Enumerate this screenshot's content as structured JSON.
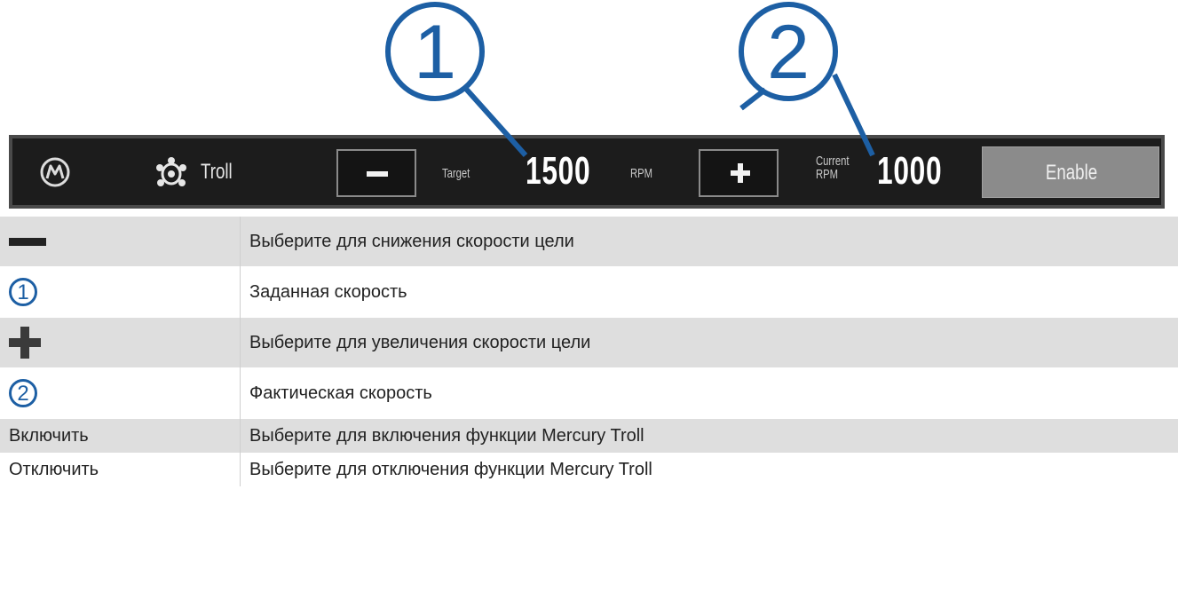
{
  "callouts": [
    "1",
    "2"
  ],
  "toolbar": {
    "mode_label": "Troll",
    "target_label": "Target",
    "target_value": "1500",
    "rpm_label": "RPM",
    "current_label_line1": "Current",
    "current_label_line2": "RPM",
    "current_value": "1000",
    "enable_label": "Enable"
  },
  "legend": {
    "rows": [
      {
        "icon": "minus-icon",
        "description": "Выберите для снижения скорости цели"
      },
      {
        "icon": "callout-1-icon",
        "label": "1",
        "description": "Заданная скорость"
      },
      {
        "icon": "plus-icon",
        "description": "Выберите для увеличения скорости цели"
      },
      {
        "icon": "callout-2-icon",
        "label": "2",
        "description": "Фактическая скорость"
      },
      {
        "label": "Включить",
        "description": "Выберите для включения функции Mercury Troll"
      },
      {
        "label": "Отключить",
        "description": "Выберите для отключения функции Mercury Troll"
      }
    ]
  },
  "colors": {
    "callout": "#1d5fa4",
    "toolbar_bg": "#1c1c1c",
    "row_shade": "#dedede"
  }
}
